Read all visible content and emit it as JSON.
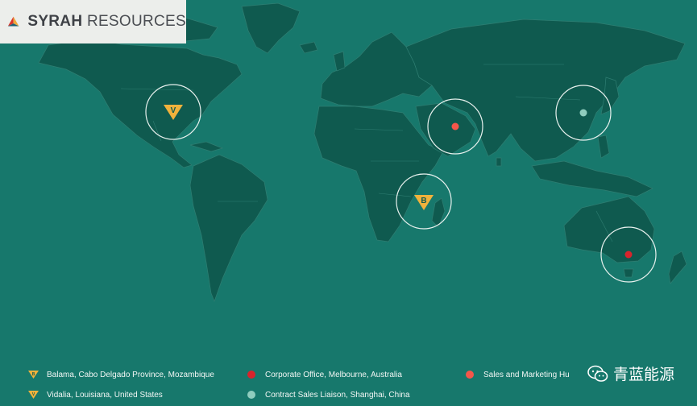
{
  "brand": {
    "name_bold": "SYRAH",
    "name_rest": " RESOURCES",
    "colors": {
      "red": "#d9352b",
      "orange": "#f0a93b",
      "teal": "#1d5f73"
    }
  },
  "markers": {
    "vidalia": {
      "letter": "V",
      "icon": "orange-triangle-marker"
    },
    "balama": {
      "letter": "B",
      "icon": "orange-triangle-marker"
    },
    "dubai": {
      "icon": "red-dot-marker"
    },
    "shanghai": {
      "icon": "teal-dot-marker"
    },
    "melbourne": {
      "icon": "dark-red-dot-marker"
    }
  },
  "legend": [
    {
      "label": "Balama, Cabo Delgado Province, Mozambique",
      "symbol": "triangle",
      "color": "#f0b23c"
    },
    {
      "label": "Vidalia, Louisiana, United States",
      "symbol": "triangle",
      "color": "#f0b23c"
    },
    {
      "label": "Corporate Office, Melbourne, Australia",
      "symbol": "dot",
      "color": "#d8242c"
    },
    {
      "label": "Contract Sales Liaison, Shanghai, China",
      "symbol": "dot",
      "color": "#8fcdbe"
    },
    {
      "label": "Sales and Marketing Hu",
      "symbol": "dot",
      "color": "#f5564a"
    }
  ],
  "watermark": {
    "text": "青蓝能源",
    "icon": "wechat-icon"
  },
  "colors": {
    "ocean": "#17786c",
    "land": "#0f5a4f",
    "border": "#2f7e72",
    "ring": "#e8f1ee"
  }
}
